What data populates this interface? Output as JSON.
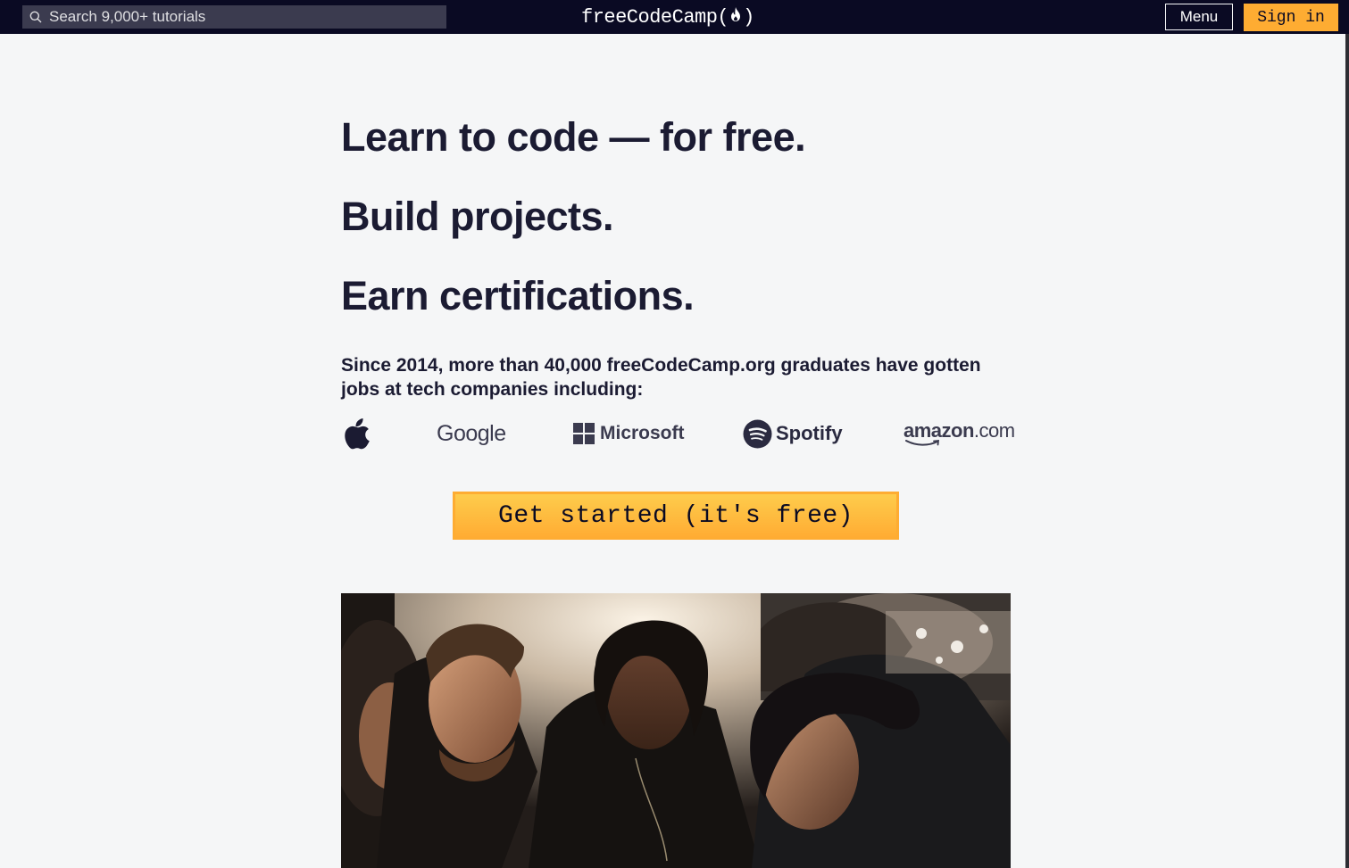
{
  "navbar": {
    "search_placeholder": "Search 9,000+ tutorials",
    "brand_left": "freeCodeCamp(",
    "brand_right": ")",
    "menu_label": "Menu",
    "signin_label": "Sign in"
  },
  "hero": {
    "line1": "Learn to code — for free.",
    "line2": "Build projects.",
    "line3": "Earn certifications.",
    "since_text": "Since 2014, more than 40,000 freeCodeCamp.org graduates have gotten jobs at tech companies including:",
    "cta_label": "Get started (it's free)"
  },
  "logos": {
    "google": "Google",
    "microsoft": "Microsoft",
    "spotify": "Spotify",
    "amazon_a": "amazon",
    "amazon_b": ".com"
  },
  "colors": {
    "nav_bg": "#0a0a23",
    "page_bg": "#f5f6f7",
    "accent": "#feac32",
    "text": "#1b1b32"
  }
}
